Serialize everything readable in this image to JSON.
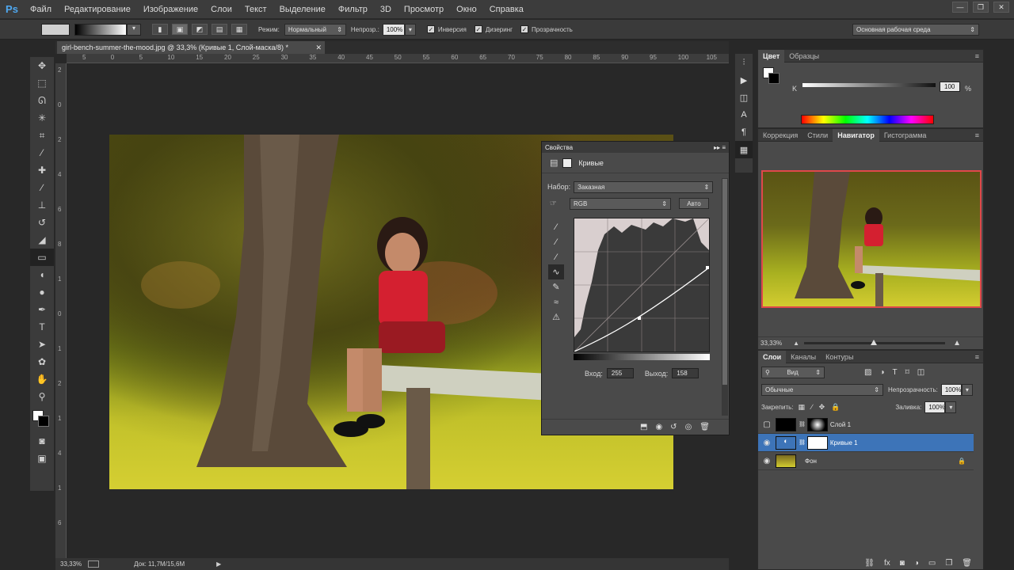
{
  "menu": {
    "logo": "Ps",
    "items": [
      "Файл",
      "Редактирование",
      "Изображение",
      "Слои",
      "Текст",
      "Выделение",
      "Фильтр",
      "3D",
      "Просмотр",
      "Окно",
      "Справка"
    ]
  },
  "options": {
    "mode_label": "Режим:",
    "mode_value": "Нормальный",
    "opacity_label": "Непрозр.:",
    "opacity_value": "100%",
    "inverse_label": "Инверсия",
    "dither_label": "Дизеринг",
    "transparency_label": "Прозрачность",
    "workspace": "Основная рабочая среда"
  },
  "document": {
    "tab_title": "girl-bench-summer-the-mood.jpg @ 33,3% (Кривые 1, Слой-маска/8) *",
    "ruler_top": [
      "5",
      "0",
      "5",
      "10",
      "15",
      "20",
      "25",
      "30",
      "35",
      "40",
      "45",
      "50",
      "55",
      "60",
      "65",
      "70",
      "75",
      "80",
      "85",
      "90",
      "95",
      "100",
      "105"
    ],
    "ruler_left": [
      "2",
      "0",
      "2",
      "4",
      "6",
      "8",
      "1",
      "0",
      "1",
      "2",
      "1",
      "4",
      "1",
      "6"
    ],
    "zoom": "33,33%",
    "doc_size": "Док: 11,7M/15,6M"
  },
  "properties": {
    "title": "Свойства",
    "panel_name": "Кривые",
    "preset_label": "Набор:",
    "preset_value": "Заказная",
    "channel_value": "RGB",
    "auto_label": "Авто",
    "input_label": "Вход:",
    "input_value": "255",
    "output_label": "Выход:",
    "output_value": "158"
  },
  "color_panel": {
    "tabs": [
      "Цвет",
      "Образцы"
    ],
    "k_label": "K",
    "k_value": "100",
    "pct": "%"
  },
  "nav_panel": {
    "tabs": [
      "Коррекция",
      "Стили",
      "Навигатор",
      "Гистограмма"
    ],
    "zoom": "33,33%"
  },
  "layers_panel": {
    "tabs": [
      "Слои",
      "Каналы",
      "Контуры"
    ],
    "filter": "Вид",
    "blend_mode": "Обычные",
    "opacity_label": "Непрозрачность:",
    "opacity_value": "100%",
    "lock_label": "Закрепить:",
    "fill_label": "Заливка:",
    "fill_value": "100%",
    "layers": [
      {
        "name": "Слой 1"
      },
      {
        "name": "Кривые 1"
      },
      {
        "name": "Фон"
      }
    ]
  },
  "colors": {
    "accent": "#3d74b8",
    "ps_blue": "#4fa8f0"
  }
}
